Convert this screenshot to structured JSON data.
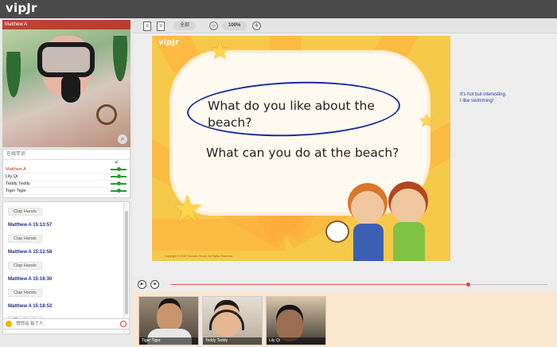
{
  "app": {
    "logo": "vipJr"
  },
  "teacher_video": {
    "name": "Matthew A"
  },
  "online_users": {
    "header": "在线学员",
    "volume_header": "◀)",
    "users": [
      {
        "name": "Matthew A",
        "role": "teacher",
        "volume": 0.5
      },
      {
        "name": "Lily Qi",
        "role": "student",
        "volume": 0.5
      },
      {
        "name": "Teddy Teddy",
        "role": "student",
        "volume": 0.5
      },
      {
        "name": "Tiger Tiger",
        "role": "student",
        "volume": 0.5
      }
    ]
  },
  "chat": {
    "messages": [
      {
        "author": "",
        "text": "Clap Hands"
      },
      {
        "author": "Matthew A 15:13:57",
        "text": "Clap Hands"
      },
      {
        "author": "Matthew A 15:13:58",
        "text": "Clap Hands"
      },
      {
        "author": "Matthew A 15:16:30",
        "text": "Clap Hands"
      },
      {
        "author": "Matthew A 15:18:53",
        "text": "Clap Hands"
      }
    ],
    "input_label": "悄悄话 每个人"
  },
  "toolbar": {
    "all_label": "全部",
    "zoom": "100%",
    "minus": "−",
    "plus": "+"
  },
  "slide": {
    "logo": "vipJr",
    "question1": "What do you like about the beach?",
    "question2": "What can you do at the beach?",
    "copyright": "Copyright © 2018 Tutorabc Group. All Rights Reserved."
  },
  "annotation": {
    "line1": "It's hot but interesting.",
    "line2": "I like swimming!"
  },
  "media": {
    "play_icon": "play-icon",
    "stop_icon": "stop-icon",
    "progress": 0.79
  },
  "students": [
    {
      "name": "Tiger Tiger"
    },
    {
      "name": "Teddy Teddy"
    },
    {
      "name": "Lily Qi"
    }
  ],
  "colors": {
    "topbar": "#4a4a4a",
    "slide_bg": "#f7c94a",
    "chat_author": "#1d2c8f",
    "teacher_name": "#c0392b",
    "volume_slider": "#2e9b2e",
    "student_strip": "#fbe7cf"
  }
}
